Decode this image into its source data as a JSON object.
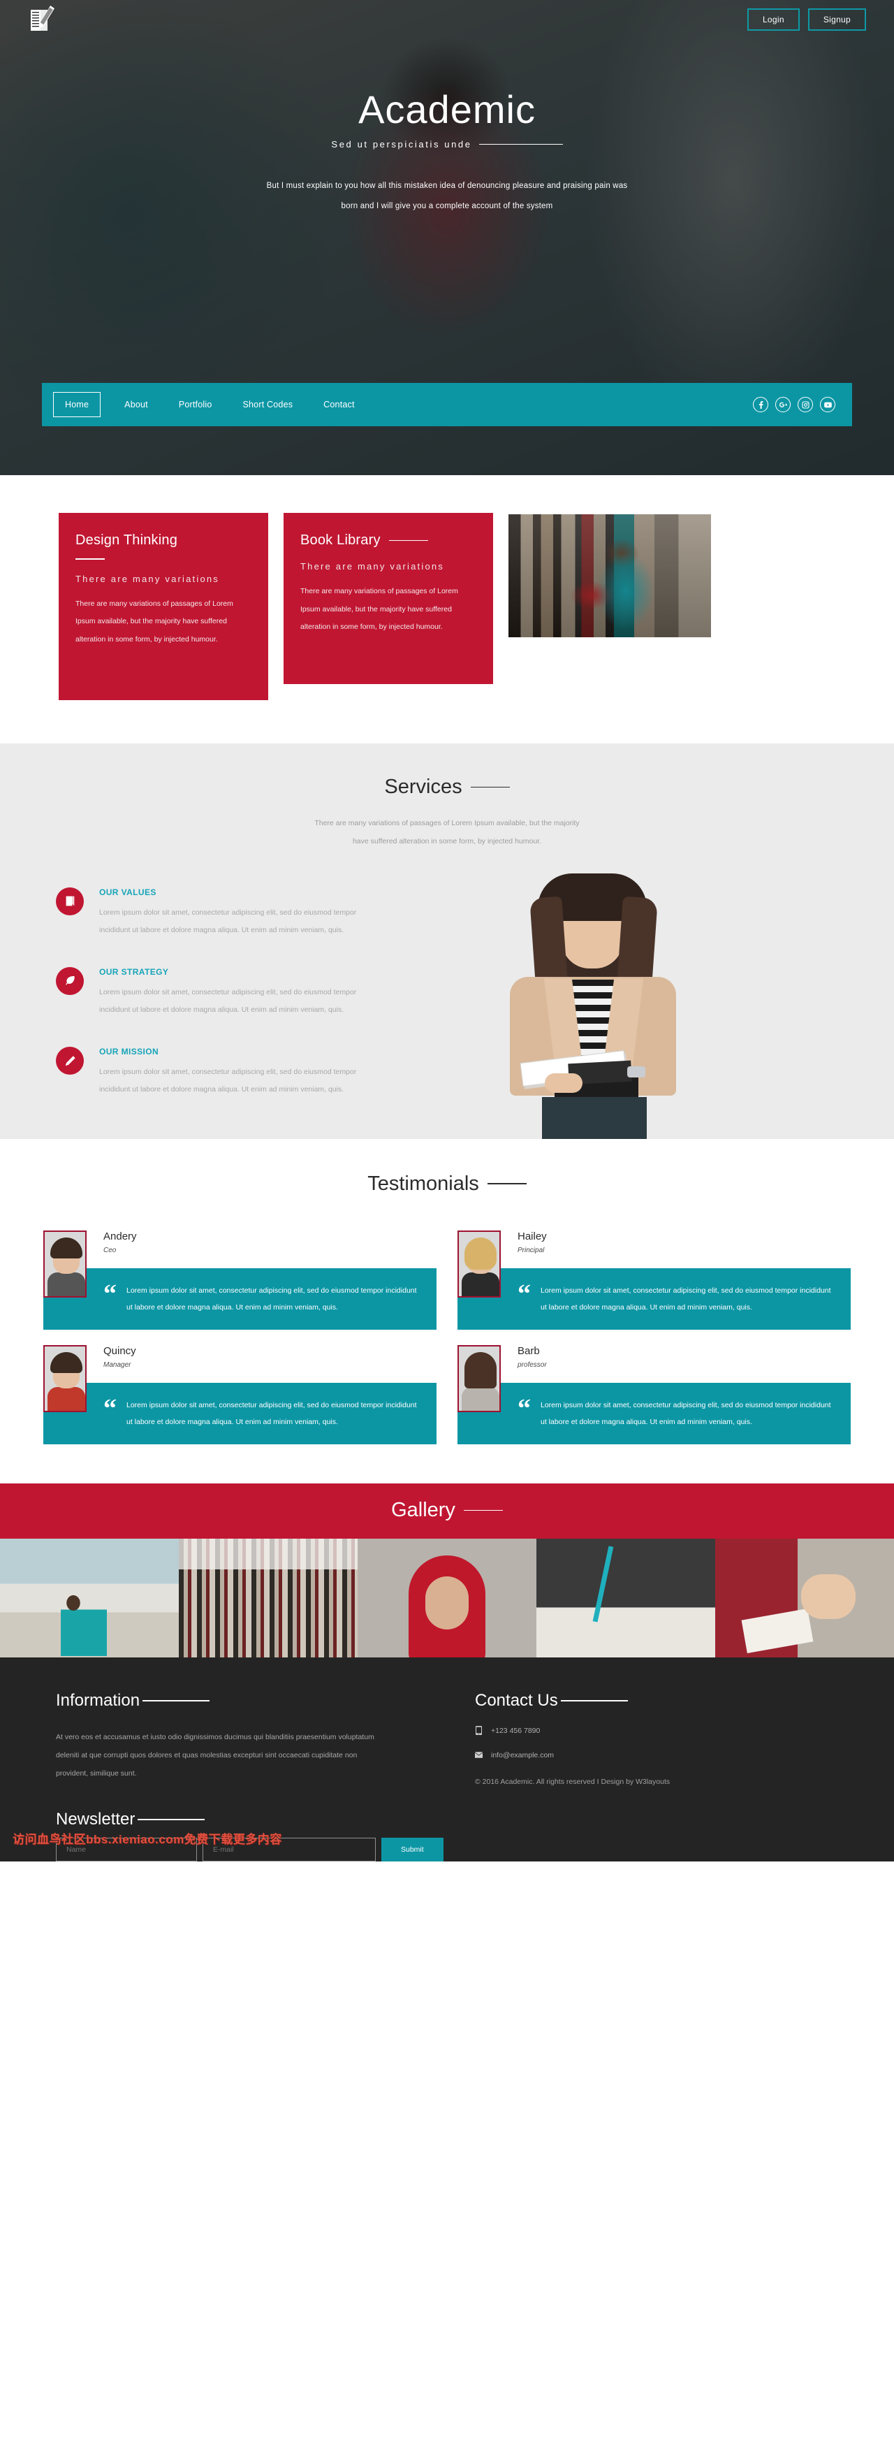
{
  "brand": {
    "logo_icon": "notebook-pen-icon",
    "name": "Academic"
  },
  "colors": {
    "teal": "#0c96a4",
    "red": "#c01632",
    "dark": "#242424",
    "heading_teal": "#16a4b8"
  },
  "auth": {
    "login": "Login",
    "signup": "Signup"
  },
  "hero": {
    "title": "Academic",
    "subtitle": "Sed ut perspiciatis unde",
    "paragraph_line1": "But I must explain to you how all this mistaken idea of denouncing pleasure and praising pain was",
    "paragraph_line2": "born and I will give you a complete account of the system"
  },
  "nav": {
    "items": [
      {
        "label": "Home",
        "active": true
      },
      {
        "label": "About",
        "active": false
      },
      {
        "label": "Portfolio",
        "active": false
      },
      {
        "label": "Short Codes",
        "active": false
      },
      {
        "label": "Contact",
        "active": false
      }
    ],
    "socials": [
      {
        "name": "facebook-icon"
      },
      {
        "name": "google-plus-icon"
      },
      {
        "name": "instagram-icon"
      },
      {
        "name": "youtube-icon"
      }
    ]
  },
  "features": [
    {
      "title": "Design Thinking",
      "subtitle": "There are many variations",
      "body": "There are many variations of passages of Lorem Ipsum available, but the majority have suffered alteration in some form, by injected humour."
    },
    {
      "title": "Book Library",
      "subtitle": "There are many variations",
      "body": "There are many variations of passages of Lorem Ipsum available, but the majority have suffered alteration in some form, by injected humour."
    }
  ],
  "feature_image": {
    "alt": "librarian-holding-books-photo"
  },
  "services": {
    "title": "Services",
    "subtitle_line1": "There are many variations of passages of Lorem Ipsum available, but the majority",
    "subtitle_line2": "have suffered alteration in some form, by injected humour.",
    "items": [
      {
        "icon": "book-icon",
        "title": "OUR VALUES",
        "body": "Lorem ipsum dolor sit amet, consectetur adipiscing elit, sed do eiusmod tempor incididunt ut labore et dolore magna aliqua. Ut enim ad minim veniam, quis."
      },
      {
        "icon": "feather-icon",
        "title": "OUR STRATEGY",
        "body": "Lorem ipsum dolor sit amet, consectetur adipiscing elit, sed do eiusmod tempor incididunt ut labore et dolore magna aliqua. Ut enim ad minim veniam, quis."
      },
      {
        "icon": "pencil-icon",
        "title": "OUR MISSION",
        "body": "Lorem ipsum dolor sit amet, consectetur adipiscing elit, sed do eiusmod tempor incididunt ut labore et dolore magna aliqua. Ut enim ad minim veniam, quis."
      }
    ],
    "image_alt": "woman-reading-book-photo"
  },
  "testimonials": {
    "title": "Testimonials",
    "quote_mark": "“",
    "items": [
      {
        "name": "Andery",
        "role": "Ceo",
        "quote": "Lorem ipsum dolor sit amet, consectetur adipiscing elit, sed do eiusmod tempor incididunt ut labore et dolore magna aliqua. Ut enim ad minim veniam, quis."
      },
      {
        "name": "Hailey",
        "role": "Principal",
        "quote": "Lorem ipsum dolor sit amet, consectetur adipiscing elit, sed do eiusmod tempor incididunt ut labore et dolore magna aliqua. Ut enim ad minim veniam, quis."
      },
      {
        "name": "Quincy",
        "role": "Manager",
        "quote": "Lorem ipsum dolor sit amet, consectetur adipiscing elit, sed do eiusmod tempor incididunt ut labore et dolore magna aliqua. Ut enim ad minim veniam, quis."
      },
      {
        "name": "Barb",
        "role": "professor",
        "quote": "Lorem ipsum dolor sit amet, consectetur adipiscing elit, sed do eiusmod tempor incididunt ut labore et dolore magna aliqua. Ut enim ad minim veniam, quis."
      }
    ]
  },
  "gallery": {
    "title": "Gallery",
    "images": [
      {
        "alt": "two-students-in-schoolyard-photo"
      },
      {
        "alt": "library-bookshelves-photo"
      },
      {
        "alt": "girl-in-red-hijab-photo"
      },
      {
        "alt": "hand-writing-with-pen-photo"
      },
      {
        "alt": "girl-reading-red-book-photo"
      }
    ]
  },
  "footer": {
    "information": {
      "title": "Information",
      "body": "At vero eos et accusamus et iusto odio dignissimos ducimus qui blanditiis praesentium voluptatum deleniti at que corrupti quos dolores et quas molestias excepturi sint occaecati cupiditate non provident, similique sunt."
    },
    "contact": {
      "title": "Contact Us",
      "phone_icon": "mobile-phone-icon",
      "phone": "+123 456 7890",
      "mail_icon": "envelope-icon",
      "email": "info@example.com",
      "copyright": "© 2016 Academic. All rights reserved I Design by W3layouts"
    },
    "newsletter": {
      "title": "Newsletter",
      "name_placeholder": "Name",
      "email_placeholder": "E-mail",
      "submit_label": "Submit"
    },
    "watermark": "访问血鸟社区bbs.xieniao.com免费下载更多内容"
  }
}
